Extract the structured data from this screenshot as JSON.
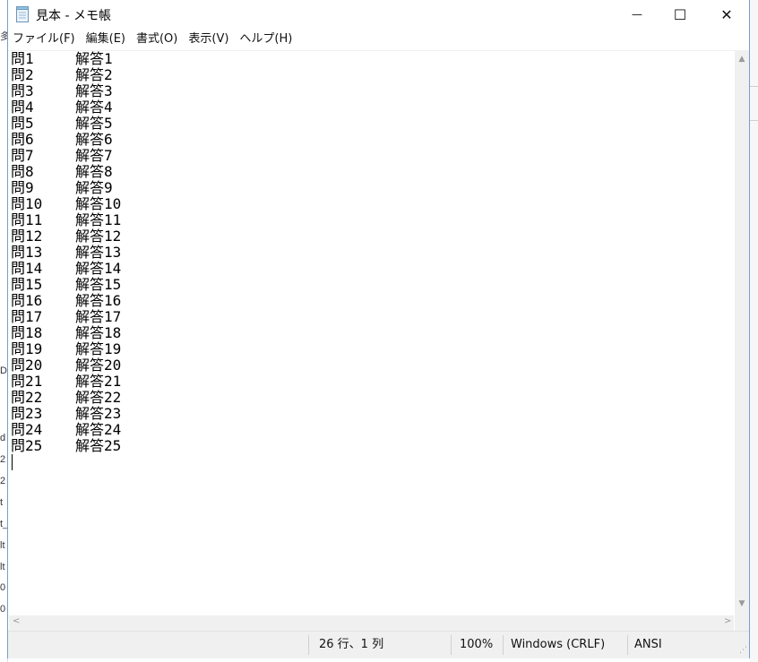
{
  "background_window": {
    "left_fragments": [
      "多",
      "D",
      "d",
      "2",
      "2",
      "t",
      "t_",
      "lt",
      "lt",
      "0",
      "0"
    ]
  },
  "window": {
    "title": "見本 - メモ帳",
    "controls": {
      "minimize": "—",
      "maximize": "☐",
      "close": "✕"
    }
  },
  "menu": [
    "ファイル(F)",
    "編集(E)",
    "書式(O)",
    "表示(V)",
    "ヘルプ(H)"
  ],
  "document": {
    "lines": [
      {
        "q": "問1",
        "a": "解答1"
      },
      {
        "q": "問2",
        "a": "解答2"
      },
      {
        "q": "問3",
        "a": "解答3"
      },
      {
        "q": "問4",
        "a": "解答4"
      },
      {
        "q": "問5",
        "a": "解答5"
      },
      {
        "q": "問6",
        "a": "解答6"
      },
      {
        "q": "問7",
        "a": "解答7"
      },
      {
        "q": "問8",
        "a": "解答8"
      },
      {
        "q": "問9",
        "a": "解答9"
      },
      {
        "q": "問10",
        "a": "解答10"
      },
      {
        "q": "問11",
        "a": "解答11"
      },
      {
        "q": "問12",
        "a": "解答12"
      },
      {
        "q": "問13",
        "a": "解答13"
      },
      {
        "q": "問14",
        "a": "解答14"
      },
      {
        "q": "問15",
        "a": "解答15"
      },
      {
        "q": "問16",
        "a": "解答16"
      },
      {
        "q": "問17",
        "a": "解答17"
      },
      {
        "q": "問18",
        "a": "解答18"
      },
      {
        "q": "問19",
        "a": "解答19"
      },
      {
        "q": "問20",
        "a": "解答20"
      },
      {
        "q": "問21",
        "a": "解答21"
      },
      {
        "q": "問22",
        "a": "解答22"
      },
      {
        "q": "問23",
        "a": "解答23"
      },
      {
        "q": "問24",
        "a": "解答24"
      },
      {
        "q": "問25",
        "a": "解答25"
      }
    ]
  },
  "scrollbars": {
    "up": "▲",
    "down": "▼",
    "left": "<",
    "right": ">"
  },
  "status": {
    "position": "26 行、1 列",
    "zoom": "100%",
    "line_ending": "Windows (CRLF)",
    "encoding": "ANSI",
    "grip": "⋰"
  },
  "icons": {
    "app": "notepad-icon"
  },
  "colors": {
    "window_border": "#7a9ccc",
    "status_bg": "#f0f0f0"
  }
}
